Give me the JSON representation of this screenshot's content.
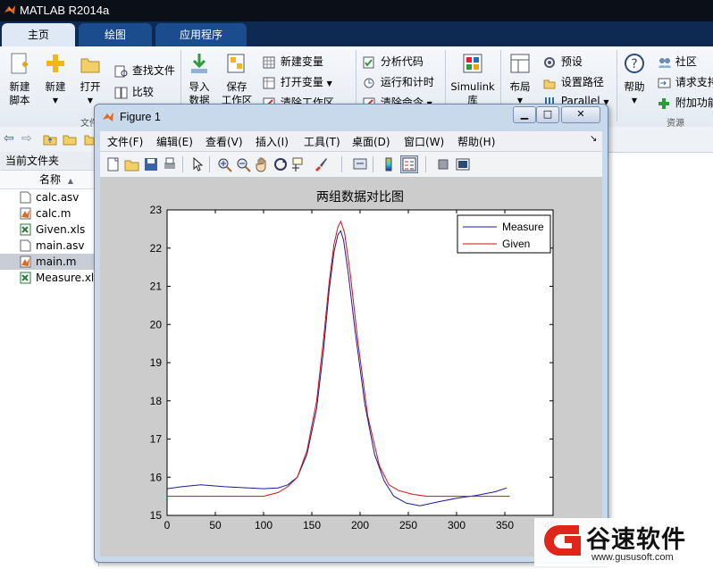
{
  "app": {
    "title": "MATLAB R2014a",
    "tabs": [
      "主页",
      "绘图",
      "应用程序"
    ]
  },
  "ribbon": {
    "new_script": "新建\n脚本",
    "new": "新建",
    "open": "打开",
    "find_files": "查找文件",
    "compare": "比较",
    "import_data": "导入\n数据",
    "save_workspace": "保存\n工作区",
    "new_variable": "新建变量",
    "open_variable": "打开变量",
    "clear_workspace": "清除工作区",
    "analyze_code": "分析代码",
    "run_and_time": "运行和计时",
    "clear_commands": "清除命令",
    "simulink": "Simulink\n库",
    "layout": "布局",
    "preferences": "预设",
    "set_path": "设置路径",
    "parallel": "Parallel",
    "help": "帮助",
    "community": "社区",
    "request_support": "请求支持",
    "add_ons": "附加功能",
    "group_file": "文件",
    "group_resources": "资源"
  },
  "current_folder": {
    "title": "当前文件夹",
    "column_name": "名称",
    "files": [
      {
        "name": "calc.asv",
        "type": "asv"
      },
      {
        "name": "calc.m",
        "type": "m"
      },
      {
        "name": "Given.xls",
        "type": "xls"
      },
      {
        "name": "main.asv",
        "type": "asv"
      },
      {
        "name": "main.m",
        "type": "m",
        "selected": true
      },
      {
        "name": "Measure.xl",
        "type": "xls"
      }
    ]
  },
  "figure": {
    "title": "Figure 1",
    "menu": [
      "文件(F)",
      "编辑(E)",
      "查看(V)",
      "插入(I)",
      "工具(T)",
      "桌面(D)",
      "窗口(W)",
      "帮助(H)"
    ],
    "toolbar_icons": [
      "new-figure-icon",
      "open-file-icon",
      "save-icon",
      "print-icon",
      "pointer-icon",
      "zoom-in-icon",
      "zoom-out-icon",
      "pan-icon",
      "rotate-icon",
      "data-cursor-icon",
      "brush-icon",
      "link-icon",
      "colorbar-icon",
      "legend-icon",
      "hide-plot-tools-icon",
      "show-plot-tools-icon"
    ]
  },
  "chart_data": {
    "type": "line",
    "title": "两组数据对比图",
    "xlabel": "",
    "ylabel": "",
    "xlim": [
      0,
      400
    ],
    "ylim": [
      15,
      23
    ],
    "xticks": [
      0,
      50,
      100,
      150,
      200,
      250,
      300,
      350,
      400
    ],
    "yticks": [
      15,
      16,
      17,
      18,
      19,
      20,
      21,
      22,
      23
    ],
    "grid": false,
    "legend": "top-right",
    "series": [
      {
        "name": "Measure",
        "color": "#1a1aa0",
        "x": [
          0,
          15,
          35,
          60,
          85,
          100,
          115,
          125,
          135,
          145,
          155,
          162,
          168,
          173,
          177,
          180,
          183,
          188,
          195,
          205,
          215,
          225,
          235,
          248,
          262,
          280,
          300,
          320,
          340,
          352
        ],
        "y": [
          15.7,
          15.75,
          15.8,
          15.75,
          15.72,
          15.7,
          15.72,
          15.8,
          16.0,
          16.6,
          17.8,
          19.3,
          20.9,
          21.9,
          22.35,
          22.45,
          22.2,
          21.3,
          19.8,
          17.9,
          16.6,
          15.9,
          15.5,
          15.32,
          15.25,
          15.35,
          15.45,
          15.52,
          15.62,
          15.72
        ]
      },
      {
        "name": "Given",
        "color": "#cc1111",
        "x": [
          0,
          25,
          50,
          75,
          100,
          115,
          125,
          135,
          145,
          155,
          162,
          168,
          173,
          177,
          180,
          184,
          190,
          198,
          208,
          220,
          230,
          240,
          255,
          270,
          300,
          330,
          355
        ],
        "y": [
          15.5,
          15.5,
          15.5,
          15.5,
          15.5,
          15.6,
          15.75,
          16.0,
          16.7,
          18.0,
          19.6,
          21.1,
          22.1,
          22.55,
          22.7,
          22.4,
          21.3,
          19.5,
          17.6,
          16.3,
          15.8,
          15.65,
          15.55,
          15.5,
          15.5,
          15.5,
          15.5
        ]
      }
    ]
  },
  "watermark": {
    "brand": "谷速软件",
    "url": "www.gususoft.com"
  }
}
